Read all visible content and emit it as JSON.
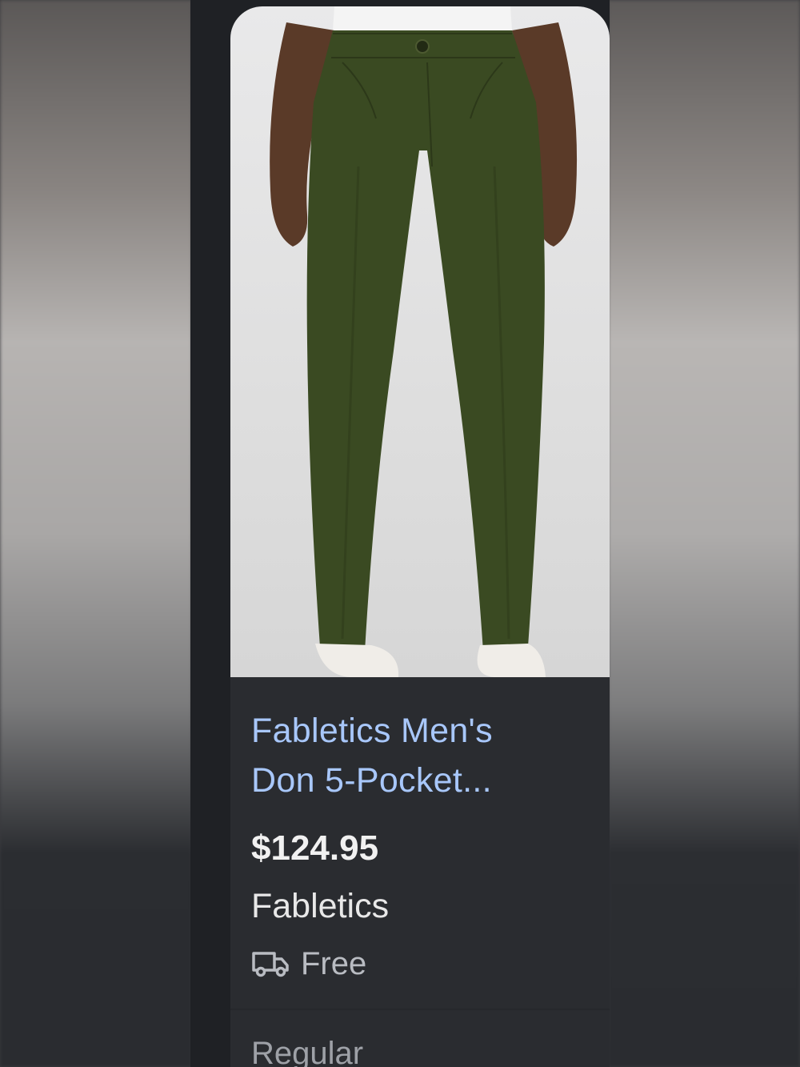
{
  "product": {
    "title_line1": "Fabletics Men's",
    "title_line2": "Don 5-Pocket...",
    "price": "$124.95",
    "seller": "Fabletics",
    "shipping": "Free",
    "shipping_icon": "truck-icon",
    "image": "olive-green-pants-photo"
  },
  "filter_label": "Regular",
  "colors": {
    "title": "#a8c7fa",
    "card_bg": "#2a2c30",
    "pants": "#3a4a22"
  }
}
